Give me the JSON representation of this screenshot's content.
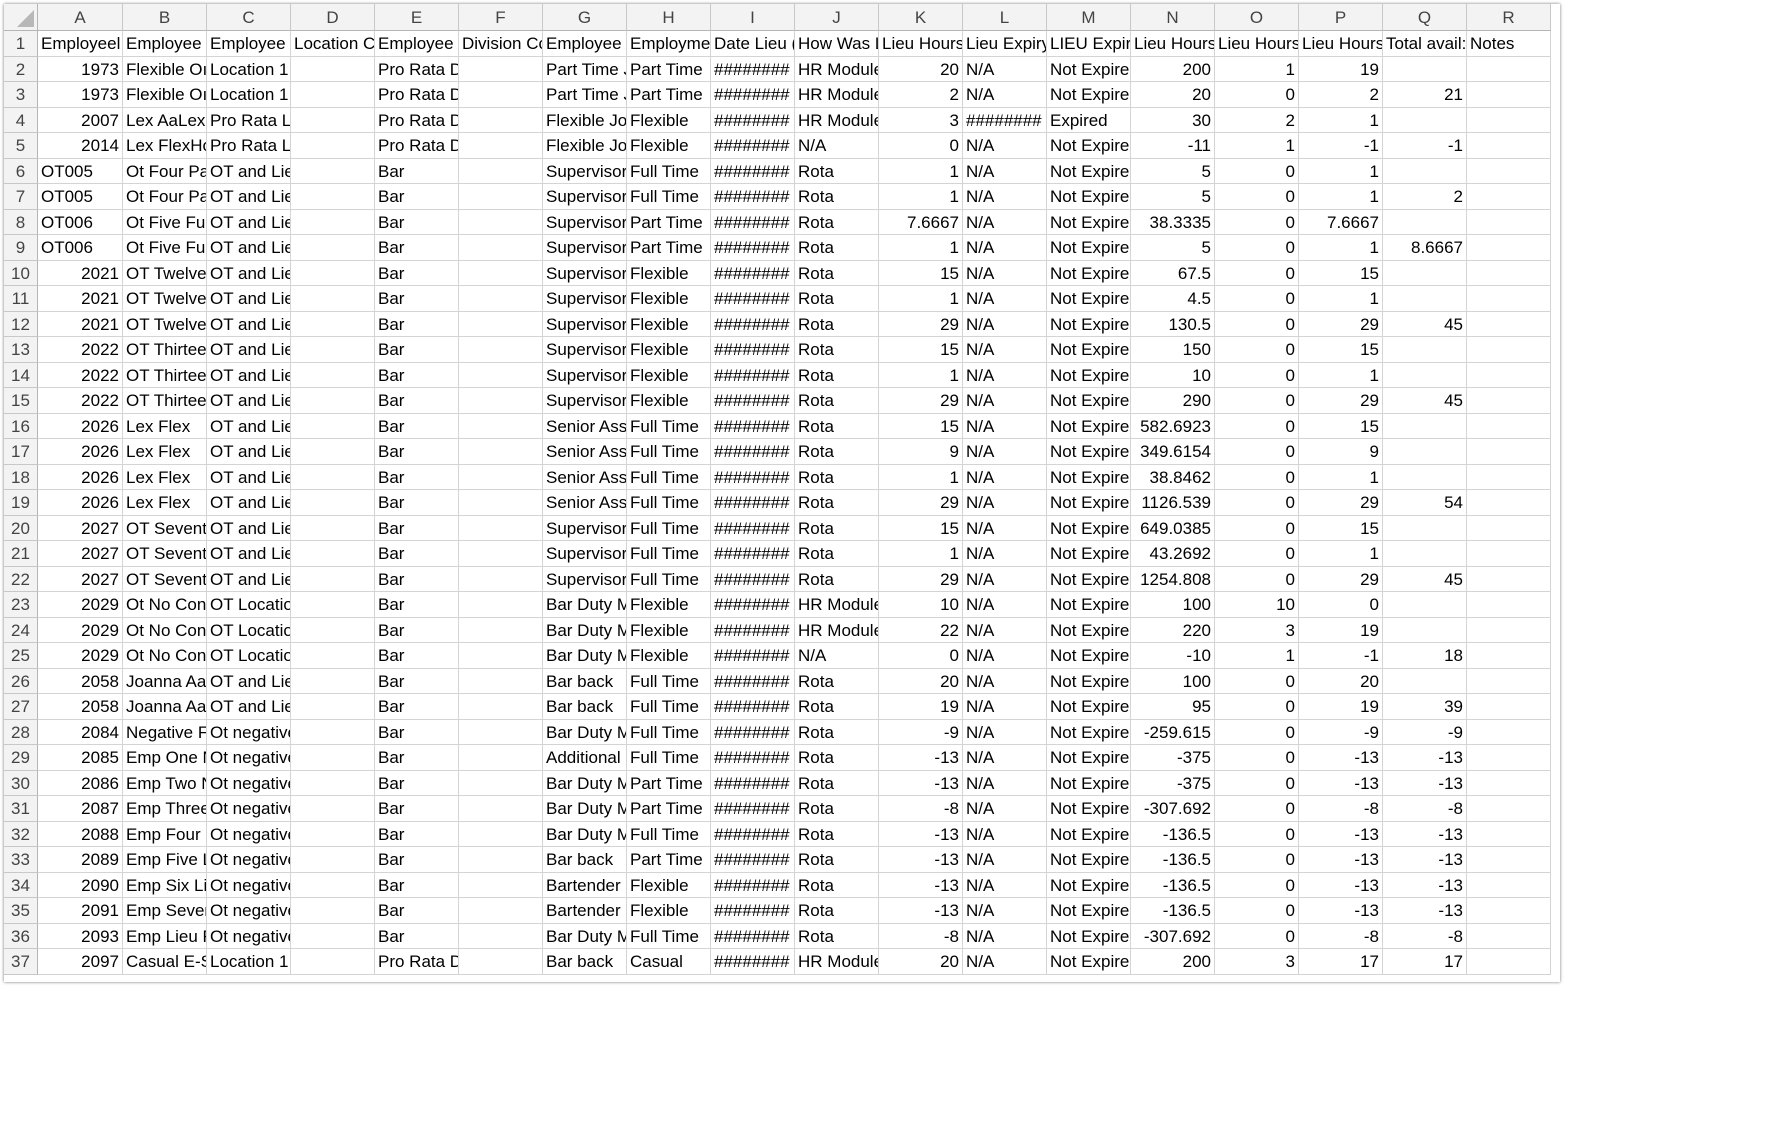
{
  "columns": [
    "A",
    "B",
    "C",
    "D",
    "E",
    "F",
    "G",
    "H",
    "I",
    "J",
    "K",
    "L",
    "M",
    "N",
    "O",
    "P",
    "Q",
    "R"
  ],
  "numeric_columns": [
    0,
    10,
    13,
    14,
    15,
    16
  ],
  "rows": [
    {
      "num": "1",
      "cells": [
        "Employeel",
        "Employee",
        "Employee",
        "Location C",
        "Employee",
        "Division Cc",
        "Employee .",
        "Employme",
        "Date Lieu (",
        "How Was L",
        "Lieu Hours",
        "Lieu Expiry",
        "LIEU Expire",
        "Lieu Hours",
        "Lieu Hours",
        "Lieu Hours",
        "Total avail:",
        "Notes"
      ],
      "header": true
    },
    {
      "num": "2",
      "cells": [
        "1973",
        "Flexible Oı",
        "Location 1",
        "",
        "Pro Rata Division",
        "",
        "Part Time J",
        "Part Time",
        "########",
        "HR Module",
        "20",
        "N/A",
        "Not Expire",
        "200",
        "1",
        "19",
        "",
        ""
      ]
    },
    {
      "num": "3",
      "cells": [
        "1973",
        "Flexible Oı",
        "Location 1",
        "",
        "Pro Rata Division",
        "",
        "Part Time J",
        "Part Time",
        "########",
        "HR Module",
        "2",
        "N/A",
        "Not Expire",
        "20",
        "0",
        "2",
        "21",
        ""
      ]
    },
    {
      "num": "4",
      "cells": [
        "2007",
        "Lex AaLex",
        "Pro Rata Location",
        "",
        "Pro Rata Division",
        "",
        "Flexible Jo",
        "Flexible",
        "########",
        "HR Module",
        "3",
        "########",
        "Expired",
        "30",
        "2",
        "1",
        "",
        ""
      ]
    },
    {
      "num": "5",
      "cells": [
        "2014",
        "Lex FlexHo",
        "Pro Rata Location",
        "",
        "Pro Rata Division",
        "",
        "Flexible Jo",
        "Flexible",
        "########",
        "N/A",
        "0",
        "N/A",
        "Not Expire",
        "-11",
        "1",
        "-1",
        "-1",
        ""
      ]
    },
    {
      "num": "6",
      "cells": [
        "OT005",
        "Ot  Four Pa",
        "OT and Lieu Hours Lo",
        "",
        "Bar",
        "",
        "Supervisor",
        "Full Time",
        "########",
        "Rota",
        "1",
        "N/A",
        "Not Expire",
        "5",
        "0",
        "1",
        "",
        ""
      ]
    },
    {
      "num": "7",
      "cells": [
        "OT005",
        "Ot  Four Pa",
        "OT and Lieu Hours Lo",
        "",
        "Bar",
        "",
        "Supervisor",
        "Full Time",
        "########",
        "Rota",
        "1",
        "N/A",
        "Not Expire",
        "5",
        "0",
        "1",
        "2",
        ""
      ]
    },
    {
      "num": "8",
      "cells": [
        "OT006",
        "Ot  Five Fu",
        "OT and Lieu Hours Lo",
        "",
        "Bar",
        "",
        "Supervisor",
        "Part Time",
        "########",
        "Rota",
        "7.6667",
        "N/A",
        "Not Expire",
        "38.3335",
        "0",
        "7.6667",
        "",
        ""
      ]
    },
    {
      "num": "9",
      "cells": [
        "OT006",
        "Ot  Five Fu",
        "OT and Lieu Hours Lo",
        "",
        "Bar",
        "",
        "Supervisor",
        "Part Time",
        "########",
        "Rota",
        "1",
        "N/A",
        "Not Expire",
        "5",
        "0",
        "1",
        "8.6667",
        ""
      ]
    },
    {
      "num": "10",
      "cells": [
        "2021",
        "OT Twelve",
        "OT and Lieu Hours Lo",
        "",
        "Bar",
        "",
        "Supervisor",
        "Flexible",
        "########",
        "Rota",
        "15",
        "N/A",
        "Not Expire",
        "67.5",
        "0",
        "15",
        "",
        ""
      ]
    },
    {
      "num": "11",
      "cells": [
        "2021",
        "OT Twelve",
        "OT and Lieu Hours Lo",
        "",
        "Bar",
        "",
        "Supervisor",
        "Flexible",
        "########",
        "Rota",
        "1",
        "N/A",
        "Not Expire",
        "4.5",
        "0",
        "1",
        "",
        ""
      ]
    },
    {
      "num": "12",
      "cells": [
        "2021",
        "OT Twelve",
        "OT and Lieu Hours Lo",
        "",
        "Bar",
        "",
        "Supervisor",
        "Flexible",
        "########",
        "Rota",
        "29",
        "N/A",
        "Not Expire",
        "130.5",
        "0",
        "29",
        "45",
        ""
      ]
    },
    {
      "num": "13",
      "cells": [
        "2022",
        "OT Thirtee",
        "OT and Lieu Hours Lo",
        "",
        "Bar",
        "",
        "Supervisor",
        "Flexible",
        "########",
        "Rota",
        "15",
        "N/A",
        "Not Expire",
        "150",
        "0",
        "15",
        "",
        ""
      ]
    },
    {
      "num": "14",
      "cells": [
        "2022",
        "OT Thirtee",
        "OT and Lieu Hours Lo",
        "",
        "Bar",
        "",
        "Supervisor",
        "Flexible",
        "########",
        "Rota",
        "1",
        "N/A",
        "Not Expire",
        "10",
        "0",
        "1",
        "",
        ""
      ]
    },
    {
      "num": "15",
      "cells": [
        "2022",
        "OT Thirtee",
        "OT and Lieu Hours Lo",
        "",
        "Bar",
        "",
        "Supervisor",
        "Flexible",
        "########",
        "Rota",
        "29",
        "N/A",
        "Not Expire",
        "290",
        "0",
        "29",
        "45",
        ""
      ]
    },
    {
      "num": "16",
      "cells": [
        "2026",
        "Lex Flex",
        "OT and Lieu Hours Lo",
        "",
        "Bar",
        "",
        "Senior Ass",
        "Full Time",
        "########",
        "Rota",
        "15",
        "N/A",
        "Not Expire",
        "582.6923",
        "0",
        "15",
        "",
        ""
      ]
    },
    {
      "num": "17",
      "cells": [
        "2026",
        "Lex Flex",
        "OT and Lieu Hours Lo",
        "",
        "Bar",
        "",
        "Senior Ass",
        "Full Time",
        "########",
        "Rota",
        "9",
        "N/A",
        "Not Expire",
        "349.6154",
        "0",
        "9",
        "",
        ""
      ]
    },
    {
      "num": "18",
      "cells": [
        "2026",
        "Lex Flex",
        "OT and Lieu Hours Lo",
        "",
        "Bar",
        "",
        "Senior Ass",
        "Full Time",
        "########",
        "Rota",
        "1",
        "N/A",
        "Not Expire",
        "38.8462",
        "0",
        "1",
        "",
        ""
      ]
    },
    {
      "num": "19",
      "cells": [
        "2026",
        "Lex Flex",
        "OT and Lieu Hours Lo",
        "",
        "Bar",
        "",
        "Senior Ass",
        "Full Time",
        "########",
        "Rota",
        "29",
        "N/A",
        "Not Expire",
        "1126.539",
        "0",
        "29",
        "54",
        ""
      ]
    },
    {
      "num": "20",
      "cells": [
        "2027",
        "OT Sevent",
        "OT and Lieu Hours Lo",
        "",
        "Bar",
        "",
        "Supervisor",
        "Full Time",
        "########",
        "Rota",
        "15",
        "N/A",
        "Not Expire",
        "649.0385",
        "0",
        "15",
        "",
        ""
      ]
    },
    {
      "num": "21",
      "cells": [
        "2027",
        "OT Sevent",
        "OT and Lieu Hours Lo",
        "",
        "Bar",
        "",
        "Supervisor",
        "Full Time",
        "########",
        "Rota",
        "1",
        "N/A",
        "Not Expire",
        "43.2692",
        "0",
        "1",
        "",
        ""
      ]
    },
    {
      "num": "22",
      "cells": [
        "2027",
        "OT Sevent",
        "OT and Lieu Hours Lo",
        "",
        "Bar",
        "",
        "Supervisor",
        "Full Time",
        "########",
        "Rota",
        "29",
        "N/A",
        "Not Expire",
        "1254.808",
        "0",
        "29",
        "45",
        ""
      ]
    },
    {
      "num": "23",
      "cells": [
        "2029",
        "Ot No Con",
        "OT Location 2",
        "",
        "Bar",
        "",
        "Bar Duty M",
        "Flexible",
        "########",
        "HR Module",
        "10",
        "N/A",
        "Not Expire",
        "100",
        "10",
        "0",
        "",
        ""
      ]
    },
    {
      "num": "24",
      "cells": [
        "2029",
        "Ot No Con",
        "OT Location 2",
        "",
        "Bar",
        "",
        "Bar Duty M",
        "Flexible",
        "########",
        "HR Module",
        "22",
        "N/A",
        "Not Expire",
        "220",
        "3",
        "19",
        "",
        ""
      ]
    },
    {
      "num": "25",
      "cells": [
        "2029",
        "Ot No Con",
        "OT Location 2",
        "",
        "Bar",
        "",
        "Bar Duty M",
        "Flexible",
        "########",
        "N/A",
        "0",
        "N/A",
        "Not Expire",
        "-10",
        "1",
        "-1",
        "18",
        ""
      ]
    },
    {
      "num": "26",
      "cells": [
        "2058",
        "Joanna Aal",
        "OT and Lieu Hours Lo",
        "",
        "Bar",
        "",
        "Bar back",
        "Full Time",
        "########",
        "Rota",
        "20",
        "N/A",
        "Not Expire",
        "100",
        "0",
        "20",
        "",
        ""
      ]
    },
    {
      "num": "27",
      "cells": [
        "2058",
        "Joanna Aal",
        "OT and Lieu Hours Lo",
        "",
        "Bar",
        "",
        "Bar back",
        "Full Time",
        "########",
        "Rota",
        "19",
        "N/A",
        "Not Expire",
        "95",
        "0",
        "19",
        "39",
        ""
      ]
    },
    {
      "num": "28",
      "cells": [
        "2084",
        "Negative F",
        "Ot negative lieu hours",
        "",
        "Bar",
        "",
        "Bar Duty M",
        "Full Time",
        "########",
        "Rota",
        "-9",
        "N/A",
        "Not Expire",
        "-259.615",
        "0",
        "-9",
        "-9",
        ""
      ]
    },
    {
      "num": "29",
      "cells": [
        "2085",
        "Emp One N",
        "Ot negative lieu hours",
        "",
        "Bar",
        "",
        "Additional",
        "Full Time",
        "########",
        "Rota",
        "-13",
        "N/A",
        "Not Expire",
        "-375",
        "0",
        "-13",
        "-13",
        ""
      ]
    },
    {
      "num": "30",
      "cells": [
        "2086",
        "Emp Two N",
        "Ot negative lieu hours",
        "",
        "Bar",
        "",
        "Bar Duty M",
        "Part Time",
        "########",
        "Rota",
        "-13",
        "N/A",
        "Not Expire",
        "-375",
        "0",
        "-13",
        "-13",
        ""
      ]
    },
    {
      "num": "31",
      "cells": [
        "2087",
        "Emp Three",
        "Ot negative lieu hours",
        "",
        "Bar",
        "",
        "Bar Duty M",
        "Part Time",
        "########",
        "Rota",
        "-8",
        "N/A",
        "Not Expire",
        "-307.692",
        "0",
        "-8",
        "-8",
        ""
      ]
    },
    {
      "num": "32",
      "cells": [
        "2088",
        "Emp Four F",
        "Ot negative lieu hours",
        "",
        "Bar",
        "",
        "Bar Duty M",
        "Full Time",
        "########",
        "Rota",
        "-13",
        "N/A",
        "Not Expire",
        "-136.5",
        "0",
        "-13",
        "-13",
        ""
      ]
    },
    {
      "num": "33",
      "cells": [
        "2089",
        "Emp Five L",
        "Ot negative lieu hours",
        "",
        "Bar",
        "",
        "Bar back",
        "Part Time",
        "########",
        "Rota",
        "-13",
        "N/A",
        "Not Expire",
        "-136.5",
        "0",
        "-13",
        "-13",
        ""
      ]
    },
    {
      "num": "34",
      "cells": [
        "2090",
        "Emp Six Lie",
        "Ot negative lieu hours",
        "",
        "Bar",
        "",
        "Bartender",
        "Flexible",
        "########",
        "Rota",
        "-13",
        "N/A",
        "Not Expire",
        "-136.5",
        "0",
        "-13",
        "-13",
        ""
      ]
    },
    {
      "num": "35",
      "cells": [
        "2091",
        "Emp Sever",
        "Ot negative lieu hours",
        "",
        "Bar",
        "",
        "Bartender",
        "Flexible",
        "########",
        "Rota",
        "-13",
        "N/A",
        "Not Expire",
        "-136.5",
        "0",
        "-13",
        "-13",
        ""
      ]
    },
    {
      "num": "36",
      "cells": [
        "2093",
        "Emp Lieu F",
        "Ot negative lieu hours",
        "",
        "Bar",
        "",
        "Bar Duty M",
        "Full Time",
        "########",
        "Rota",
        "-8",
        "N/A",
        "Not Expire",
        "-307.692",
        "0",
        "-8",
        "-8",
        ""
      ]
    },
    {
      "num": "37",
      "cells": [
        "2097",
        "Casual E-S",
        "Location 1",
        "",
        "Pro Rata Division",
        "",
        "Bar back",
        "Casual",
        "########",
        "HR Module",
        "20",
        "N/A",
        "Not Expire",
        "200",
        "3",
        "17",
        "17",
        ""
      ]
    }
  ]
}
